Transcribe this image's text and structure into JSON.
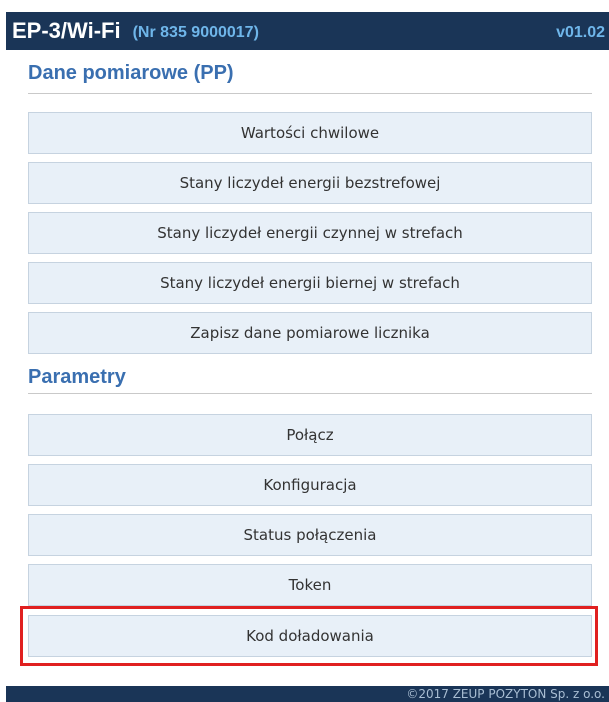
{
  "header": {
    "title": "EP-3/Wi-Fi",
    "serial": "(Nr 835 9000017)",
    "version": "v01.02"
  },
  "sections": {
    "measurement": {
      "title": "Dane pomiarowe (PP)",
      "items": [
        "Wartości chwilowe",
        "Stany liczydeł energii bezstrefowej",
        "Stany liczydeł energii czynnej w strefach",
        "Stany liczydeł energii biernej w strefach",
        "Zapisz dane pomiarowe licznika"
      ]
    },
    "parameters": {
      "title": "Parametry",
      "items": [
        "Połącz",
        "Konfiguracja",
        "Status połączenia",
        "Token",
        "Kod doładowania"
      ]
    }
  },
  "footer": {
    "copyright": "©2017 ZEUP POZYTON Sp. z o.o."
  },
  "colors": {
    "header_bg": "#1a3557",
    "accent": "#3a6fb0",
    "button_bg": "#e8f0f8",
    "highlight": "#e02020"
  }
}
